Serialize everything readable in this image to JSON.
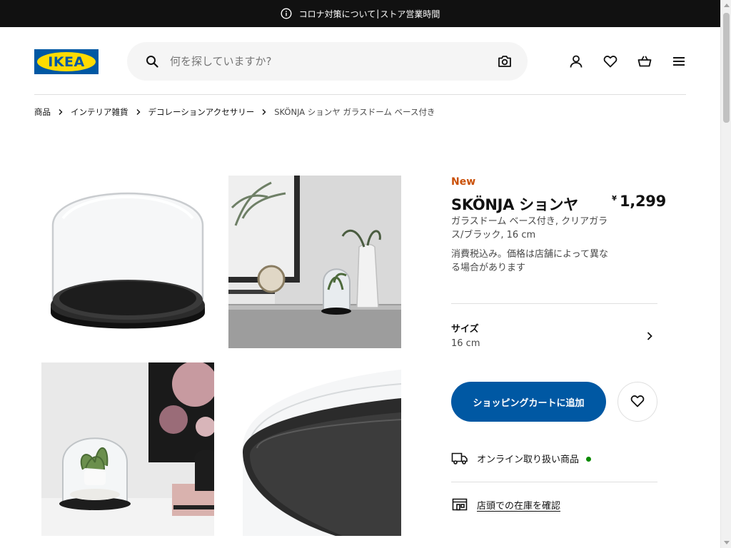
{
  "banner": {
    "icon": "info-icon",
    "link1": "コロナ対策について",
    "separator": "|",
    "link2": "ストア営業時間"
  },
  "header": {
    "logo_text": "IKEA",
    "search_placeholder": "何を探していますか?",
    "icons": [
      "search-icon",
      "camera-icon",
      "user-icon",
      "heart-icon",
      "cart-icon",
      "menu-icon"
    ]
  },
  "breadcrumb": {
    "items": [
      "商品",
      "インテリア雑貨",
      "デコレーションアクセサリー",
      "SKÖNJA ションヤ ガラスドーム ベース付き"
    ]
  },
  "product": {
    "badge": "New",
    "name": "SKÖNJA ションヤ",
    "currency": "¥",
    "price": "1,299",
    "description": "ガラスドーム ベース付き, クリアガラス/ブラック, 16 cm",
    "tax_note": "消費税込み。価格は店舗によって異なる場合があります",
    "size_label": "サイズ",
    "size_value": "16 cm",
    "add_to_cart": "ショッピングカートに追加",
    "online_text": "オンライン取り扱い商品",
    "store_text": "店頭での在庫を確認"
  },
  "colors": {
    "brand_blue": "#0058a3",
    "brand_yellow": "#ffdb00",
    "new_orange": "#ca5008",
    "available_green": "#0a8a00",
    "banner_bg": "#111111"
  }
}
